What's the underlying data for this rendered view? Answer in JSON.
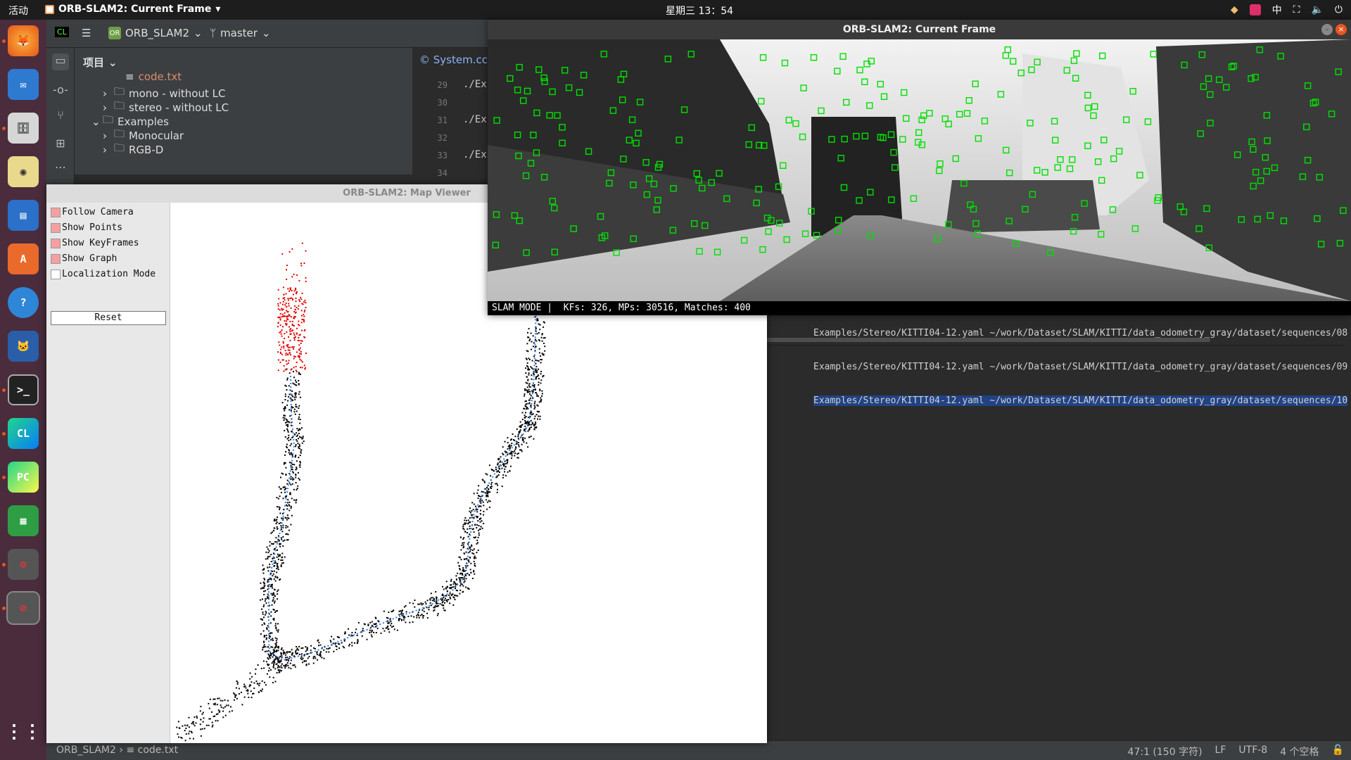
{
  "topbar": {
    "activities": "活动",
    "app_menu": "ORB-SLAM2: Current Frame",
    "clock": "星期三 13：54",
    "ime": "中"
  },
  "dock": {
    "items": [
      "firefox",
      "thunderbird",
      "files",
      "rhythmbox",
      "writer",
      "software",
      "help",
      "cat-app",
      "terminal",
      "CL",
      "PC",
      "calc",
      "blocked",
      "blocked"
    ]
  },
  "ide": {
    "project_name": "ORB_SLAM2",
    "project_badge": "OR",
    "branch": "master",
    "project_view_label": "项目",
    "tree": [
      {
        "label": "code.txt",
        "indent": 3,
        "type": "file"
      },
      {
        "label": "mono - without LC",
        "indent": 2,
        "type": "folder"
      },
      {
        "label": "stereo - without LC",
        "indent": 2,
        "type": "folder"
      },
      {
        "label": "Examples",
        "indent": 1,
        "type": "folder-open"
      },
      {
        "label": "Monocular",
        "indent": 2,
        "type": "folder"
      },
      {
        "label": "RGB-D",
        "indent": 2,
        "type": "folder"
      }
    ],
    "editor_tab": "System.cc",
    "lines": [
      {
        "n": "29",
        "code": "./Ex"
      },
      {
        "n": "30",
        "code": ""
      },
      {
        "n": "31",
        "code": "./Ex"
      },
      {
        "n": "32",
        "code": ""
      },
      {
        "n": "33",
        "code": "./Ex"
      },
      {
        "n": "34",
        "code": ""
      }
    ],
    "terminal_lines": [
      {
        "text": "Examples/Stereo/KITTI04-12.yaml ~/work/Dataset/SLAM/KITTI/data_odometry_gray/dataset/sequences/08",
        "selected": false
      },
      {
        "text": "Examples/Stereo/KITTI04-12.yaml ~/work/Dataset/SLAM/KITTI/data_odometry_gray/dataset/sequences/09",
        "selected": false
      },
      {
        "text": "Examples/Stereo/KITTI04-12.yaml ~/work/Dataset/SLAM/KITTI/data_odometry_gray/dataset/sequences/10",
        "selected": true
      }
    ],
    "status": {
      "breadcrumb_project": "ORB_SLAM2",
      "breadcrumb_file": "code.txt",
      "position": "47:1 (150 字符)",
      "line_sep": "LF",
      "encoding": "UTF-8",
      "indent": "4 个空格"
    }
  },
  "map_viewer": {
    "title": "ORB-SLAM2: Map Viewer",
    "options": [
      {
        "label": "Follow Camera",
        "checked": true
      },
      {
        "label": "Show Points",
        "checked": true
      },
      {
        "label": "Show KeyFrames",
        "checked": true
      },
      {
        "label": "Show Graph",
        "checked": true
      },
      {
        "label": "Localization Mode",
        "checked": false
      }
    ],
    "reset_label": "Reset"
  },
  "current_frame": {
    "title": "ORB-SLAM2: Current Frame",
    "status_line": "SLAM MODE |  KFs: 326, MPs: 30516, Matches: 400"
  },
  "colors": {
    "feature_box": "#00e000",
    "map_points": "#000000",
    "local_points": "#e00000",
    "trajectory": "#3b7cd6",
    "selection": "#214283"
  }
}
